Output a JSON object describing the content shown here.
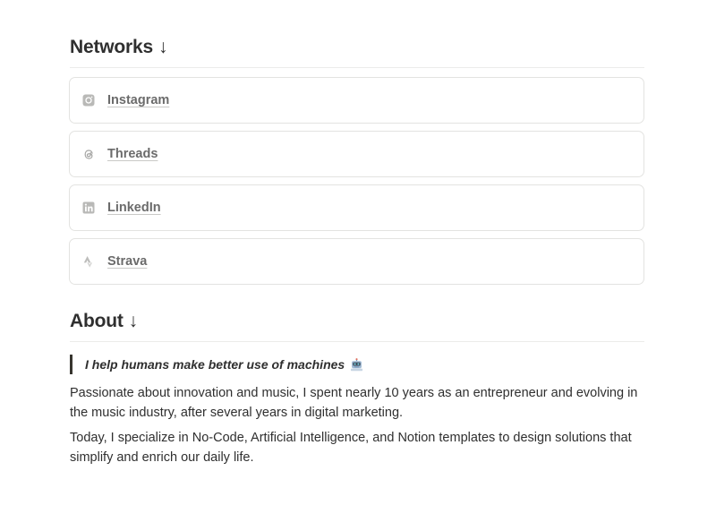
{
  "networks": {
    "heading": "Networks",
    "arrow": "↓",
    "links": [
      {
        "label": "Instagram",
        "icon": "instagram-icon"
      },
      {
        "label": "Threads",
        "icon": "threads-icon"
      },
      {
        "label": "LinkedIn",
        "icon": "linkedin-icon"
      },
      {
        "label": "Strava",
        "icon": "strava-icon"
      }
    ]
  },
  "about": {
    "heading": "About",
    "arrow": "↓",
    "quote": "I help humans make better use of machines",
    "quote_icon": "robot-icon",
    "paragraphs": [
      "Passionate about innovation and music, I spent nearly 10 years as an entrepreneur and evolving in the music industry, after several years in digital marketing.",
      "Today, I specialize in No-Code, Artificial Intelligence, and Notion templates to design solutions that simplify and enrich our daily life."
    ]
  },
  "colors": {
    "text": "#37352f",
    "muted_link": "#6b6b6b",
    "border": "#e3e3e1",
    "icon_gray": "#a5a5a3"
  }
}
